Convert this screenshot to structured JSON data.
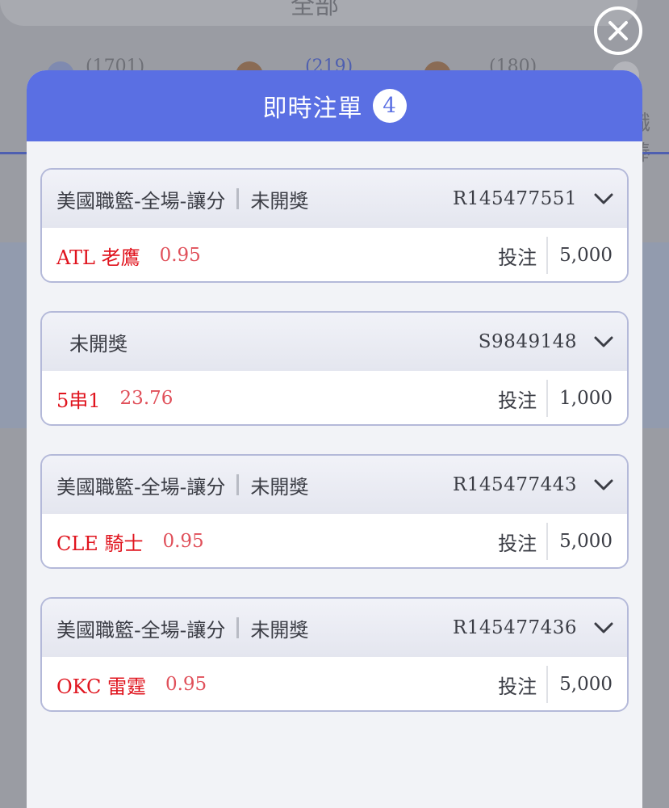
{
  "background": {
    "header_title": "全部",
    "tabs": [
      {
        "count": "(1701)"
      },
      {
        "count": "(219)"
      },
      {
        "count": "(180)"
      },
      {
        "label": "職棒"
      }
    ]
  },
  "modal": {
    "title": "即時注單",
    "count": "4",
    "bet_label": "投注",
    "bets": [
      {
        "league": "美國職籃-全場-讓分",
        "status": "未開獎",
        "ticket": "R145477551",
        "selection": "ATL 老鷹",
        "odds": "0.95",
        "amount": "5,000"
      },
      {
        "league": "",
        "status": "未開獎",
        "ticket": "S9849148",
        "selection": "5串1",
        "odds": "23.76",
        "amount": "1,000"
      },
      {
        "league": "美國職籃-全場-讓分",
        "status": "未開獎",
        "ticket": "R145477443",
        "selection": "CLE 騎士",
        "odds": "0.95",
        "amount": "5,000"
      },
      {
        "league": "美國職籃-全場-讓分",
        "status": "未開獎",
        "ticket": "R145477436",
        "selection": "OKC 雷霆",
        "odds": "0.95",
        "amount": "5,000"
      }
    ]
  },
  "colors": {
    "header_bg": "#5a6fe3",
    "selection_red": "#e0141e",
    "card_border": "#b4b9d9"
  },
  "icons": {
    "close": "close-icon",
    "expand": "chevron-down-icon"
  }
}
